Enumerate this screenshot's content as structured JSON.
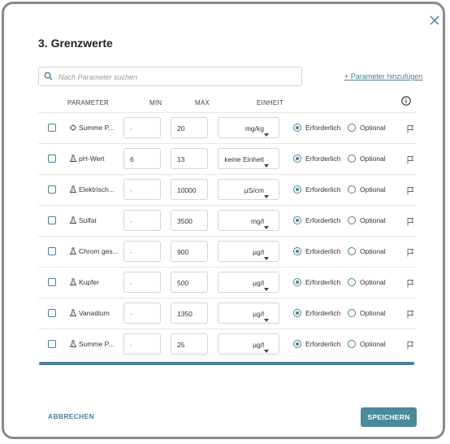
{
  "dialog": {
    "title": "3. Grenzwerte",
    "search_placeholder": "Nach Parameter suchen",
    "add_parameter": "+ Parameter hinzufügen",
    "cancel": "ABBRECHEN",
    "save": "SPEICHERN"
  },
  "table": {
    "headers": {
      "parameter": "PARAMETER",
      "min": "MIN",
      "max": "MAX",
      "unit": "EINHEIT"
    },
    "required_label": "Erforderlich",
    "optional_label": "Optional",
    "rows": [
      {
        "name": "Summe P...",
        "icon": "bacteria-icon",
        "min": "-",
        "max": "20",
        "unit": "mg/kg",
        "required": true
      },
      {
        "name": "pH-Wert",
        "icon": "flask-icon",
        "min": "6",
        "max": "13",
        "unit": "keine Einheit",
        "required": true
      },
      {
        "name": "Elektrisch...",
        "icon": "flask-icon",
        "min": "-",
        "max": "10000",
        "unit": "µS/cm",
        "required": true
      },
      {
        "name": "Sulfat",
        "icon": "flask-icon",
        "min": "-",
        "max": "3500",
        "unit": "mg/l",
        "required": true
      },
      {
        "name": "Chrom ges...",
        "icon": "flask-icon",
        "min": "-",
        "max": "900",
        "unit": "µg/l",
        "required": true
      },
      {
        "name": "Kupfer",
        "icon": "flask-icon",
        "min": "-",
        "max": "500",
        "unit": "µg/l",
        "required": true
      },
      {
        "name": "Vanadium",
        "icon": "flask-icon",
        "min": "-",
        "max": "1350",
        "unit": "µg/l",
        "required": true
      },
      {
        "name": "Summe P...",
        "icon": "flask-icon",
        "min": "-",
        "max": "25",
        "unit": "µg/l",
        "required": true
      }
    ]
  },
  "colors": {
    "accent": "#4a7f95",
    "save_button": "#4a8a9a"
  }
}
